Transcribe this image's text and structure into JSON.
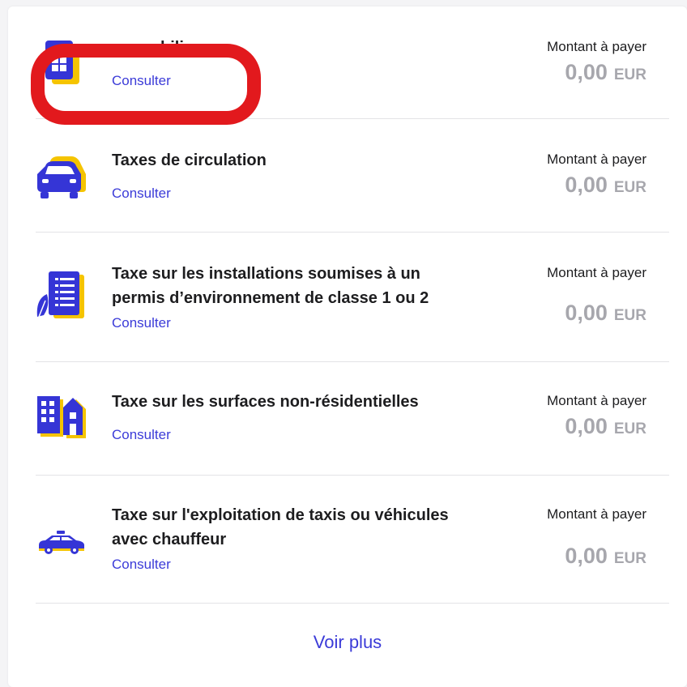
{
  "colors": {
    "accent": "#3b3bd8",
    "icon_primary": "#3535d6",
    "icon_secondary": "#f5c400",
    "amount_gray": "#a7a7ad",
    "highlight": "#e2191d"
  },
  "amount_label": "Montant à payer",
  "rows": [
    {
      "icon": "building-icon",
      "title": "…pr…bilier",
      "consult_label": "Consulter",
      "amount": "0,00",
      "currency": "EUR"
    },
    {
      "icon": "car-icon",
      "title": "Taxes de circulation",
      "consult_label": "Consulter",
      "amount": "0,00",
      "currency": "EUR"
    },
    {
      "icon": "document-leaf-icon",
      "title": "Taxe sur les installations soumises à un permis d’environnement de classe 1 ou 2",
      "consult_label": "Consulter",
      "amount": "0,00",
      "currency": "EUR"
    },
    {
      "icon": "buildings-icon",
      "title": "Taxe sur les surfaces non-résidentielles",
      "consult_label": "Consulter",
      "amount": "0,00",
      "currency": "EUR"
    },
    {
      "icon": "taxi-icon",
      "title": "Taxe sur l'exploitation de taxis ou véhicules avec chauffeur",
      "consult_label": "Consulter",
      "amount": "0,00",
      "currency": "EUR"
    }
  ],
  "see_more_label": "Voir plus"
}
